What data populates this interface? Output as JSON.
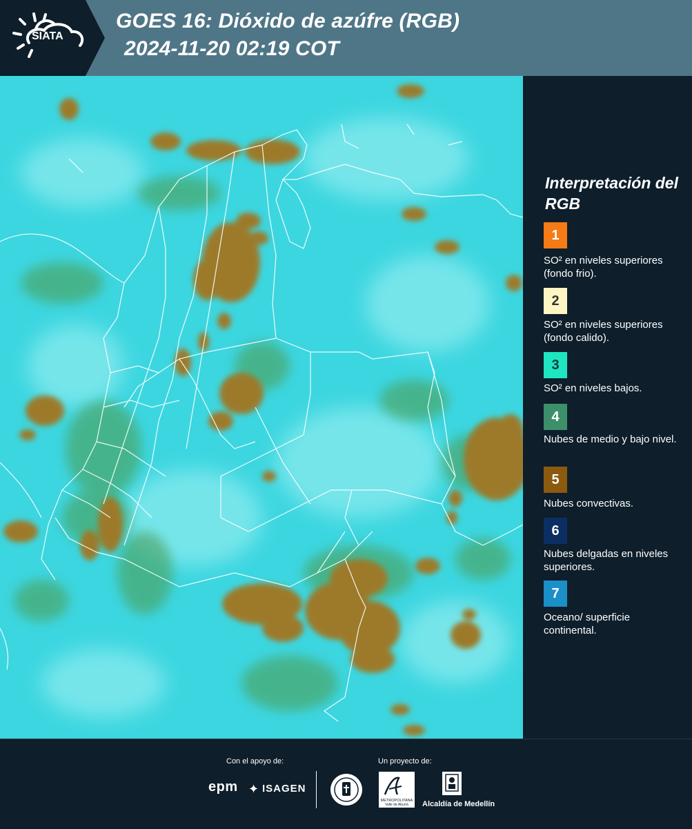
{
  "header": {
    "logo_text": "SIATA",
    "title_line1": "GOES 16: Dióxido de azúfre (RGB)",
    "title_line2": "2024-11-20 02:19 COT"
  },
  "map": {
    "background_color": "#3cd6e0",
    "boundary_color": "#ffffff",
    "convective_cloud_color": "#9c7a2c",
    "midlevel_cloud_color": "#4e9a4c"
  },
  "legend": {
    "title": "Interpretación del RGB",
    "items": [
      {
        "number": "1",
        "color": "#f47b16",
        "text_color": "#ffffff",
        "label": "SO² en niveles superiores (fondo frio)."
      },
      {
        "number": "2",
        "color": "#fdf6c3",
        "text_color": "#333333",
        "label": "SO² en niveles superiores (fondo calido)."
      },
      {
        "number": "3",
        "color": "#1de6c1",
        "text_color": "#0c3a3a",
        "label": "SO² en niveles bajos."
      },
      {
        "number": "4",
        "color": "#3c8f6a",
        "text_color": "#ffffff",
        "label": "Nubes de medio y bajo nivel."
      },
      {
        "number": "5",
        "color": "#8b5a0f",
        "text_color": "#ffffff",
        "label": "Nubes convectivas."
      },
      {
        "number": "6",
        "color": "#0b2e63",
        "text_color": "#ffffff",
        "label": "Nubes delgadas en niveles superiores."
      },
      {
        "number": "7",
        "color": "#1b8fc8",
        "text_color": "#ffffff",
        "label": "Oceano/ superficie continental."
      }
    ]
  },
  "footer": {
    "support_label": "Con el apoyo de:",
    "project_label": "Un proyecto de:",
    "epm": "epm",
    "isagen": "ISAGEN",
    "area_text": "METROPOLITANA",
    "area_sub": "Valle de Aburrá",
    "alcaldia": "Alcaldía de Medellín"
  }
}
